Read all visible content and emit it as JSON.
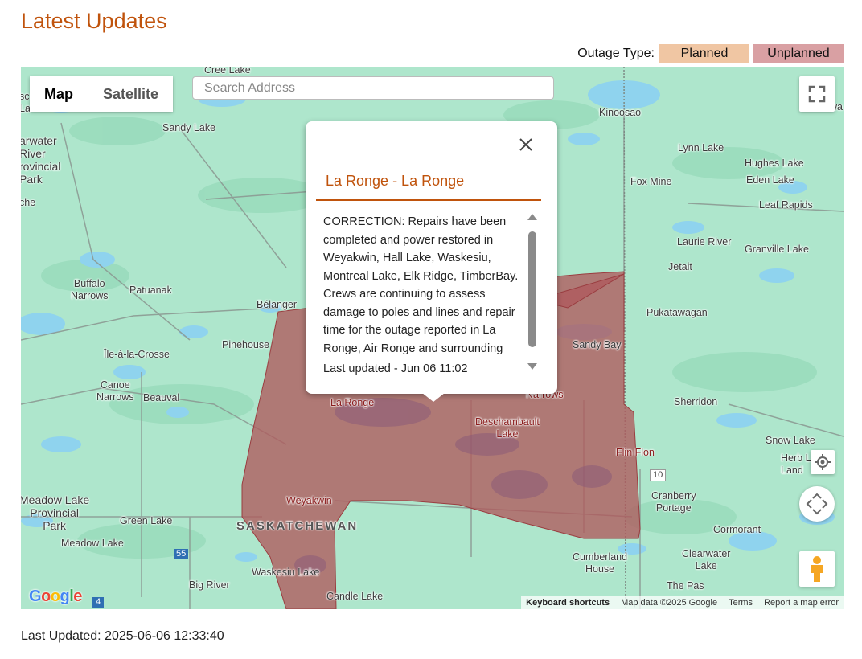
{
  "header": {
    "title": "Latest Updates"
  },
  "legend": {
    "label": "Outage Type:",
    "planned": "Planned",
    "unplanned": "Unplanned",
    "planned_color": "#f0c6a3",
    "unplanned_color": "#d9a0a3"
  },
  "map_controls": {
    "map_label": "Map",
    "satellite_label": "Satellite",
    "search_placeholder": "Search Address"
  },
  "popup": {
    "title": "La Ronge - La Ronge",
    "body": "CORRECTION: Repairs have been completed and power restored in Weyakwin, Hall Lake, Waskesiu, Montreal Lake, Elk Ridge, TimberBay. Crews are continuing to assess damage to poles and lines and repair time for the outage reported in La Ronge, Air Ronge and surrounding rurals south of La Ronge.",
    "last_updated": "Last updated - Jun 06 11:02"
  },
  "places": {
    "cree_lake": "Cree Lake",
    "sandy_lake": "Sandy Lake",
    "clearwater_park": "arwater\nRiver\nrovincial\nPark",
    "che": "che",
    "sc": "sc\nLa",
    "buffalo_narrows": "Buffalo\nNarrows",
    "patuanak": "Patuanak",
    "belanger": "Bélanger",
    "pinehouse": "Pinehouse",
    "ile_a_la_crosse": "Île-à-la-Crosse",
    "canoe_narrows": "Canoe\nNarrows",
    "beauval": "Beauval",
    "la_ronge": "La Ronge",
    "deschambault": "Deschambault\nLake",
    "narrows": "Narrows",
    "weyakwin": "Weyakwin",
    "saskatchewan": "SASKATCHEWAN",
    "meadow_lake_park": "Meadow Lake\nProvincial\nPark",
    "green_lake": "Green Lake",
    "meadow_lake": "Meadow Lake",
    "waskesiu": "Waskesiu Lake",
    "big_river": "Big River",
    "candle_lake": "Candle Lake",
    "kinoosao": "Kinoosao",
    "lynn_lake": "Lynn Lake",
    "hughes_lake": "Hughes Lake",
    "fox_mine": "Fox Mine",
    "eden_lake": "Eden Lake",
    "leaf_rapids": "Leaf Rapids",
    "laurie_river": "Laurie River",
    "granville_lake": "Granville Lake",
    "jetait": "Jetait",
    "pukatawagan": "Pukatawagan",
    "sandy_bay": "Sandy Bay",
    "sherridon": "Sherridon",
    "snow_lake": "Snow Lake",
    "herb_lake": "Herb L\nLand",
    "flin_flon": "Flin Flon",
    "hwy10": "10",
    "cranberry_portage": "Cranberry\nPortage",
    "cormorant": "Cormorant",
    "cumberland_house": "Cumberland\nHouse",
    "clearwater_lake": "Clearwater\nLake",
    "the_pas": "The Pas",
    "hwy55": "55",
    "hwy4": "4",
    "wa": "wa"
  },
  "attribution": {
    "logo": "Google",
    "keyboard": "Keyboard shortcuts",
    "mapdata": "Map data ©2025 Google",
    "terms": "Terms",
    "report": "Report a map error"
  },
  "footer": {
    "last_updated": "Last Updated: 2025-06-06 12:33:40"
  }
}
